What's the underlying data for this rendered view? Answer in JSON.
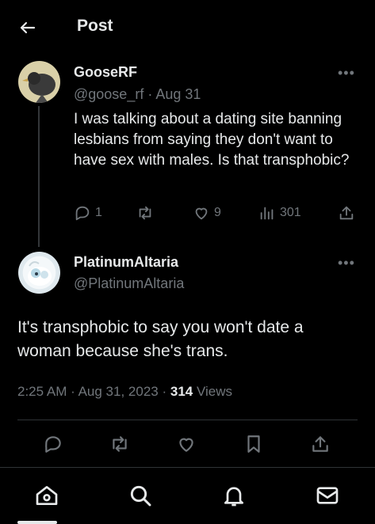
{
  "header": {
    "title": "Post"
  },
  "parent_post": {
    "name": "GooseRF",
    "handle": "@goose_rf",
    "separator": "·",
    "date": "Aug 31",
    "text": "I was talking about a dating site banning lesbians from saying they don't want to have sex with males. Is that transphobic?",
    "replies": "1",
    "likes": "9",
    "views": "301"
  },
  "main_post": {
    "name": "PlatinumAltaria",
    "handle": "@PlatinumAltaria",
    "text": "It's transphobic to say you won't date a woman because she's trans.",
    "time": "2:25 AM",
    "dot1": "·",
    "date": "Aug 31, 2023",
    "dot2": "·",
    "views_count": "314",
    "views_label": "Views"
  },
  "more_glyph": "•••",
  "colors": {
    "background": "#000000",
    "text": "#e7e9ea",
    "secondary": "#71767b",
    "divider": "#2f3336"
  }
}
